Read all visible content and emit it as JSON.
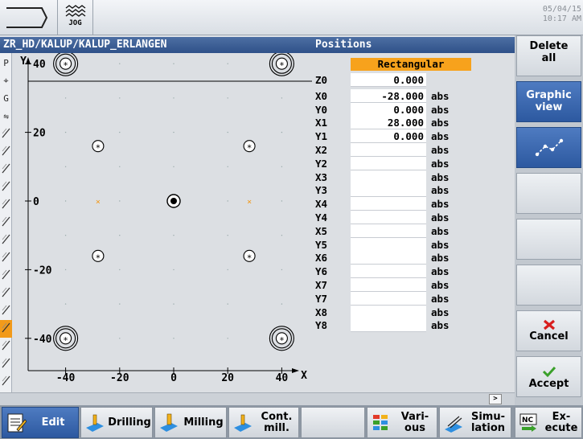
{
  "header": {
    "jog_label": "JOG",
    "date": "05/04/15",
    "time": "10:17 AM"
  },
  "graphic": {
    "title": "ZR_HD/KALUP/KALUP_ERLANGEN",
    "x_axis_label": "X",
    "y_axis_label": "Y",
    "x_ticks": [
      "-40",
      "-20",
      "0",
      "20",
      "40"
    ],
    "y_ticks": [
      "40",
      "20",
      "0",
      "-20",
      "-40"
    ]
  },
  "toolstrip": {
    "items": [
      {
        "icon": "program-icon",
        "text": "P"
      },
      {
        "icon": "position-icon",
        "text": "⌖"
      },
      {
        "icon": "gcode-icon",
        "text": "G"
      },
      {
        "icon": "settings-icon",
        "text": "⇋"
      },
      {
        "icon": "drill-icon",
        "text": ""
      },
      {
        "icon": "drill-icon-2",
        "text": ""
      },
      {
        "icon": "circle-icon",
        "text": ""
      },
      {
        "icon": "line-icon",
        "text": ""
      },
      {
        "icon": "line-icon-2",
        "text": ""
      },
      {
        "icon": "contour-icon",
        "text": ""
      },
      {
        "icon": "pocket-icon",
        "text": ""
      },
      {
        "icon": "contour-icon-2",
        "text": ""
      },
      {
        "icon": "pocket-icon-2",
        "text": ""
      },
      {
        "icon": "slot-icon",
        "text": ""
      },
      {
        "icon": "slot-icon-2",
        "text": ""
      },
      {
        "icon": "positions-icon",
        "text": ""
      },
      {
        "icon": "contour-icon-3",
        "text": ""
      },
      {
        "icon": "mill-icon",
        "text": ""
      },
      {
        "icon": "end-icon",
        "text": ""
      }
    ]
  },
  "positions": {
    "title": "Positions",
    "pattern": "Rectangular",
    "rows": [
      {
        "label": "Z0",
        "value": "0.000",
        "unit": ""
      },
      {
        "label": "X0",
        "value": "-28.000",
        "unit": "abs"
      },
      {
        "label": "Y0",
        "value": "0.000",
        "unit": "abs"
      },
      {
        "label": "X1",
        "value": "28.000",
        "unit": "abs"
      },
      {
        "label": "Y1",
        "value": "0.000",
        "unit": "abs"
      },
      {
        "label": "X2",
        "value": "",
        "unit": "abs"
      },
      {
        "label": "Y2",
        "value": "",
        "unit": "abs"
      },
      {
        "label": "X3",
        "value": "",
        "unit": "abs"
      },
      {
        "label": "Y3",
        "value": "",
        "unit": "abs"
      },
      {
        "label": "X4",
        "value": "",
        "unit": "abs"
      },
      {
        "label": "Y4",
        "value": "",
        "unit": "abs"
      },
      {
        "label": "X5",
        "value": "",
        "unit": "abs"
      },
      {
        "label": "Y5",
        "value": "",
        "unit": "abs"
      },
      {
        "label": "X6",
        "value": "",
        "unit": "abs"
      },
      {
        "label": "Y6",
        "value": "",
        "unit": "abs"
      },
      {
        "label": "X7",
        "value": "",
        "unit": "abs"
      },
      {
        "label": "Y7",
        "value": "",
        "unit": "abs"
      },
      {
        "label": "X8",
        "value": "",
        "unit": "abs"
      },
      {
        "label": "Y8",
        "value": "",
        "unit": "abs"
      }
    ]
  },
  "scroll": {
    "arrow": ">"
  },
  "vsoftkeys": {
    "delete_all": [
      "Delete",
      "all"
    ],
    "graphic_view": [
      "Graphic",
      "view"
    ],
    "cancel": "Cancel",
    "accept": "Accept"
  },
  "hsoftkeys": {
    "edit": "Edit",
    "drilling": "Drilling",
    "milling": "Milling",
    "cont_mill": [
      "Cont.",
      "mill."
    ],
    "various": [
      "Vari-",
      "ous"
    ],
    "simulation": [
      "Simu-",
      "lation"
    ],
    "execute": [
      "Ex-",
      "ecute"
    ],
    "nc_icon_text": "NC"
  },
  "colors": {
    "accent_orange": "#f7a21c",
    "softkey_blue": "#3a66ad",
    "title_blue": "#3b5f96",
    "cancel_red": "#d81e1e",
    "accept_green": "#3aa02a"
  }
}
